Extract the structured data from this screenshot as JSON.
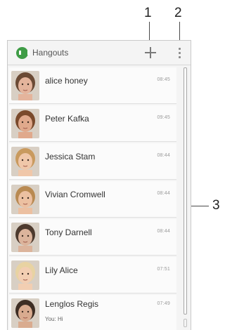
{
  "callouts": {
    "one": "1",
    "two": "2",
    "three": "3"
  },
  "app": {
    "title": "Hangouts",
    "logo_icon": "hangouts-logo-icon",
    "add_icon": "plus-icon",
    "menu_icon": "overflow-menu-icon"
  },
  "conversations": [
    {
      "name": "alice honey",
      "time": "08:45",
      "preview": "",
      "skin": "#e4b49c",
      "hair": "#6b4a35"
    },
    {
      "name": "Peter Kafka",
      "time": "09:45",
      "preview": "",
      "skin": "#e0a98c",
      "hair": "#7a4a2c"
    },
    {
      "name": "Jessica Stam",
      "time": "08:44",
      "preview": "",
      "skin": "#f0c7a9",
      "hair": "#c99a5e"
    },
    {
      "name": "Vivian Cromwell",
      "time": "08:44",
      "preview": "",
      "skin": "#ecc0a1",
      "hair": "#b98a52"
    },
    {
      "name": "Tony Darnell",
      "time": "08:44",
      "preview": "",
      "skin": "#dcb49c",
      "hair": "#4d3a2e"
    },
    {
      "name": "Lily Alice",
      "time": "07:51",
      "preview": "",
      "skin": "#f2ceb2",
      "hair": "#e8d3a2"
    },
    {
      "name": "Lenglos Regis",
      "time": "07:49",
      "preview": "You: Hi",
      "skin": "#d9ab8f",
      "hair": "#3e2e24"
    }
  ]
}
